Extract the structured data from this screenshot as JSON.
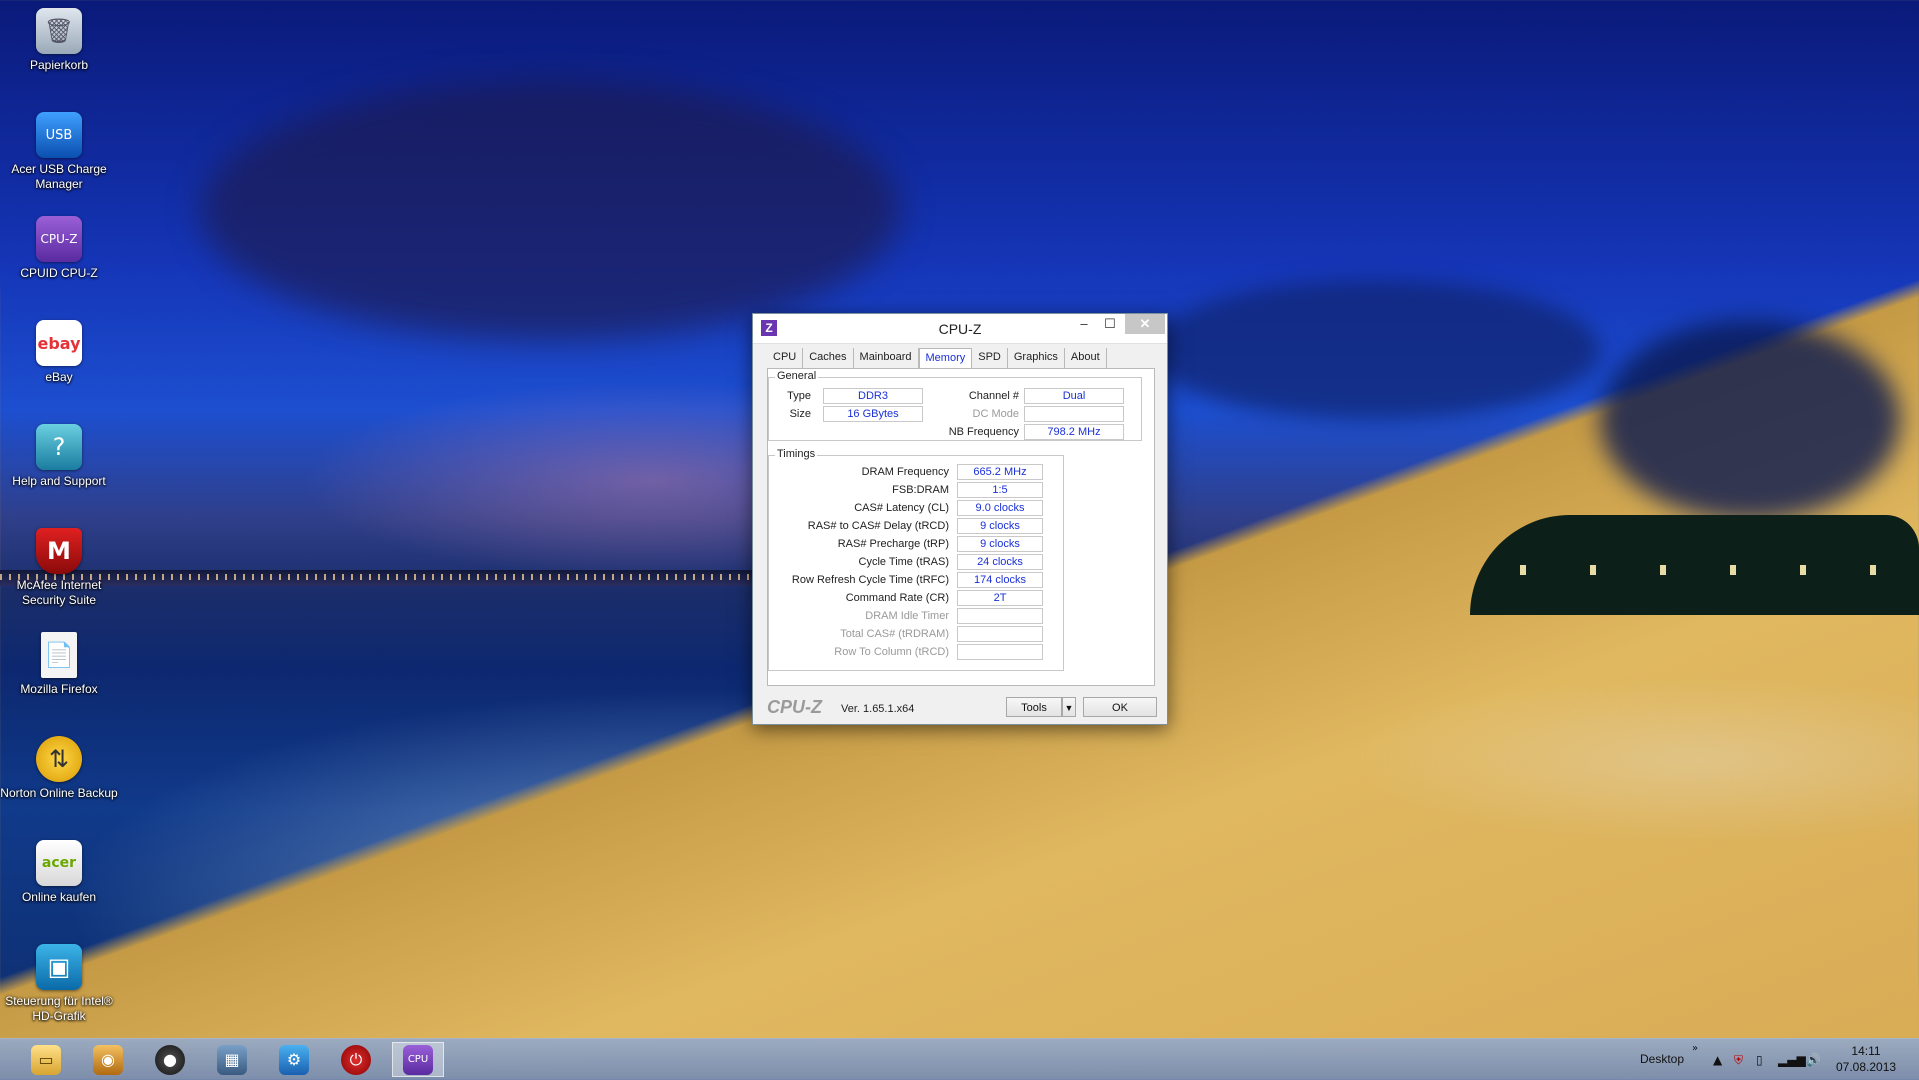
{
  "desktop": {
    "icons": [
      {
        "label": "Papierkorb",
        "icon": "recycle-bin-icon"
      },
      {
        "label": "Acer USB Charge Manager",
        "icon": "usb-charge-icon"
      },
      {
        "label": "CPUID CPU-Z",
        "icon": "cpuz-icon"
      },
      {
        "label": "eBay",
        "icon": "ebay-icon"
      },
      {
        "label": "Help and Support",
        "icon": "help-icon"
      },
      {
        "label": "McAfee Internet Security Suite",
        "icon": "mcafee-icon"
      },
      {
        "label": "Mozilla Firefox",
        "icon": "firefox-icon"
      },
      {
        "label": "Norton Online Backup",
        "icon": "norton-icon"
      },
      {
        "label": "Online kaufen",
        "icon": "shopping-bag-icon"
      },
      {
        "label": "Steuerung für Intel® HD-Grafik",
        "icon": "intel-graphics-icon"
      }
    ]
  },
  "window": {
    "title": "CPU-Z",
    "tabs": [
      "CPU",
      "Caches",
      "Mainboard",
      "Memory",
      "SPD",
      "Graphics",
      "About"
    ],
    "active_tab": "Memory",
    "general": {
      "title": "General",
      "type_label": "Type",
      "type_value": "DDR3",
      "size_label": "Size",
      "size_value": "16 GBytes",
      "channel_label": "Channel #",
      "channel_value": "Dual",
      "dcmode_label": "DC Mode",
      "dcmode_value": "",
      "nbfreq_label": "NB Frequency",
      "nbfreq_value": "798.2 MHz"
    },
    "timings": {
      "title": "Timings",
      "rows": [
        {
          "label": "DRAM Frequency",
          "value": "665.2 MHz",
          "enabled": true
        },
        {
          "label": "FSB:DRAM",
          "value": "1:5",
          "enabled": true
        },
        {
          "label": "CAS# Latency (CL)",
          "value": "9.0 clocks",
          "enabled": true
        },
        {
          "label": "RAS# to CAS# Delay (tRCD)",
          "value": "9 clocks",
          "enabled": true
        },
        {
          "label": "RAS# Precharge (tRP)",
          "value": "9 clocks",
          "enabled": true
        },
        {
          "label": "Cycle Time (tRAS)",
          "value": "24 clocks",
          "enabled": true
        },
        {
          "label": "Row Refresh Cycle Time (tRFC)",
          "value": "174 clocks",
          "enabled": true
        },
        {
          "label": "Command Rate (CR)",
          "value": "2T",
          "enabled": true
        },
        {
          "label": "DRAM Idle Timer",
          "value": "",
          "enabled": false
        },
        {
          "label": "Total CAS# (tRDRAM)",
          "value": "",
          "enabled": false
        },
        {
          "label": "Row To Column (tRCD)",
          "value": "",
          "enabled": false
        }
      ]
    },
    "footer": {
      "logo": "CPU-Z",
      "version": "Ver. 1.65.1.x64",
      "tools_label": "Tools",
      "ok_label": "OK"
    }
  },
  "taskbar": {
    "apps": [
      "file-explorer-icon",
      "media-app-icon",
      "speaker-app-icon",
      "photo-app-icon",
      "settings-app-icon",
      "power-app-icon",
      "cpuz-taskbar-icon"
    ],
    "desktop_label": "Desktop",
    "time": "14:11",
    "date": "07.08.2013"
  }
}
